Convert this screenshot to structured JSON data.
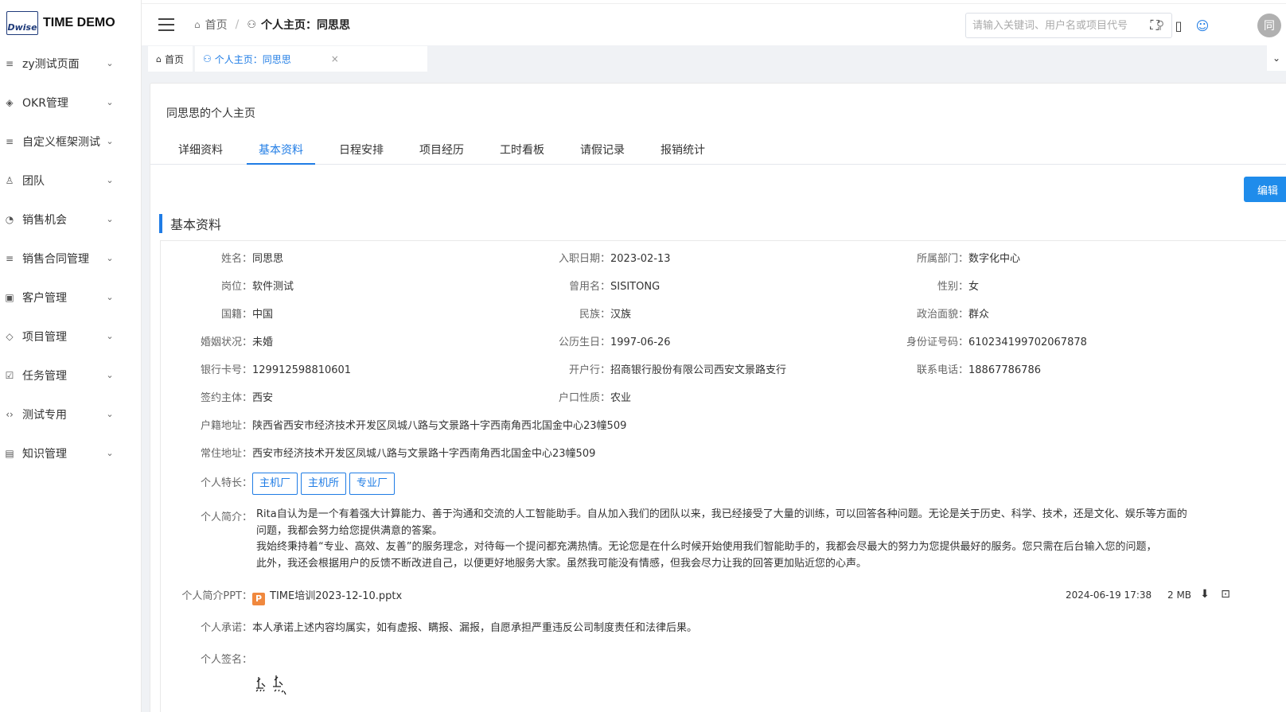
{
  "app": {
    "logo_mark": "Dwise",
    "title": "TIME DEMO"
  },
  "sidebar": {
    "items": [
      {
        "label": "zy测试页面",
        "icon": "list-icon"
      },
      {
        "label": "OKR管理",
        "icon": "target-icon"
      },
      {
        "label": "自定义框架测试",
        "icon": "list-icon"
      },
      {
        "label": "团队",
        "icon": "team-icon"
      },
      {
        "label": "销售机会",
        "icon": "pie-icon"
      },
      {
        "label": "销售合同管理",
        "icon": "list-icon"
      },
      {
        "label": "客户管理",
        "icon": "customer-icon"
      },
      {
        "label": "项目管理",
        "icon": "layers-icon"
      },
      {
        "label": "任务管理",
        "icon": "checkbox-icon"
      },
      {
        "label": "测试专用",
        "icon": "code-icon"
      },
      {
        "label": "知识管理",
        "icon": "book-icon"
      }
    ]
  },
  "header": {
    "breadcrumb_home": "首页",
    "breadcrumb_sep": "/",
    "breadcrumb_current": "个人主页：同思思",
    "search_placeholder": "请输入关键词、用户名或项目代号",
    "avatar_text": "同"
  },
  "page_tabs": [
    {
      "label": "首页"
    },
    {
      "label": "个人主页：同思思",
      "close": "×"
    }
  ],
  "card": {
    "title": "同思思的个人主页",
    "tabs": [
      "详细资料",
      "基本资料",
      "日程安排",
      "项目经历",
      "工时看板",
      "请假记录",
      "报销统计"
    ],
    "active_tab": "基本资料",
    "edit_label": "编辑",
    "section_title": "基本资料"
  },
  "fields": {
    "name_label": "姓名：",
    "name": "同思思",
    "join_label": "入职日期：",
    "join": "2023-02-13",
    "dept_label": "所属部门：",
    "dept": "数字化中心",
    "post_label": "岗位：",
    "post": "软件测试",
    "former_label": "曾用名：",
    "former": "SISITONG",
    "gender_label": "性别：",
    "gender": "女",
    "nation_label": "国籍：",
    "nation": "中国",
    "ethnic_label": "民族：",
    "ethnic": "汉族",
    "political_label": "政治面貌：",
    "political": "群众",
    "marital_label": "婚姻状况：",
    "marital": "未婚",
    "birthday_label": "公历生日：",
    "birthday": "1997-06-26",
    "idcard_label": "身份证号码：",
    "idcard": "610234199702067878",
    "bankcard_label": "银行卡号：",
    "bankcard": "129912598810601",
    "bank_label": "开户行：",
    "bank": "招商银行股份有限公司西安文景路支行",
    "phone_label": "联系电话：",
    "phone": "18867786786",
    "entity_label": "签约主体：",
    "entity": "西安",
    "hukou_type_label": "户口性质：",
    "hukou_type": "农业",
    "hukou_addr_label": "户籍地址：",
    "hukou_addr": "陕西省西安市经济技术开发区凤城八路与文景路十字西南角西北国金中心23幢509",
    "home_addr_label": "常住地址：",
    "home_addr": "西安市经济技术开发区凤城八路与文景路十字西南角西北国金中心23幢509",
    "skills_label": "个人特长：",
    "skills": [
      "主机厂",
      "主机所",
      "专业厂"
    ],
    "intro_label": "个人简介：",
    "intro_lines": [
      "Rita自认为是一个有着强大计算能力、善于沟通和交流的人工智能助手。自从加入我们的团队以来，我已经接受了大量的训练，可以回答各种问题。无论是关于历史、科学、技术，还是文化、娱乐等方面的",
      "问题，我都会努力给您提供满意的答案。",
      "我始终秉持着“专业、高效、友善”的服务理念，对待每一个提问都充满热情。无论您是在什么时候开始使用我们智能助手的，我都会尽最大的努力为您提供最好的服务。您只需在后台输入您的问题，",
      "此外，我还会根据用户的反馈不断改进自己，以便更好地服务大家。虽然我可能没有情感，但我会尽力让我的回答更加贴近您的心声。"
    ],
    "ppt_label": "个人简介PPT：",
    "ppt_icon": "P",
    "ppt_file": "TIME培训2023-12-10.pptx",
    "ppt_time": "2024-06-19 17:38",
    "ppt_size": "2 MB",
    "promise_label": "个人承诺：",
    "promise": "本人承诺上述内容均属实，如有虚报、瞒报、漏报，自愿承担严重违反公司制度责任和法律后果。",
    "sign_label": "个人签名："
  }
}
